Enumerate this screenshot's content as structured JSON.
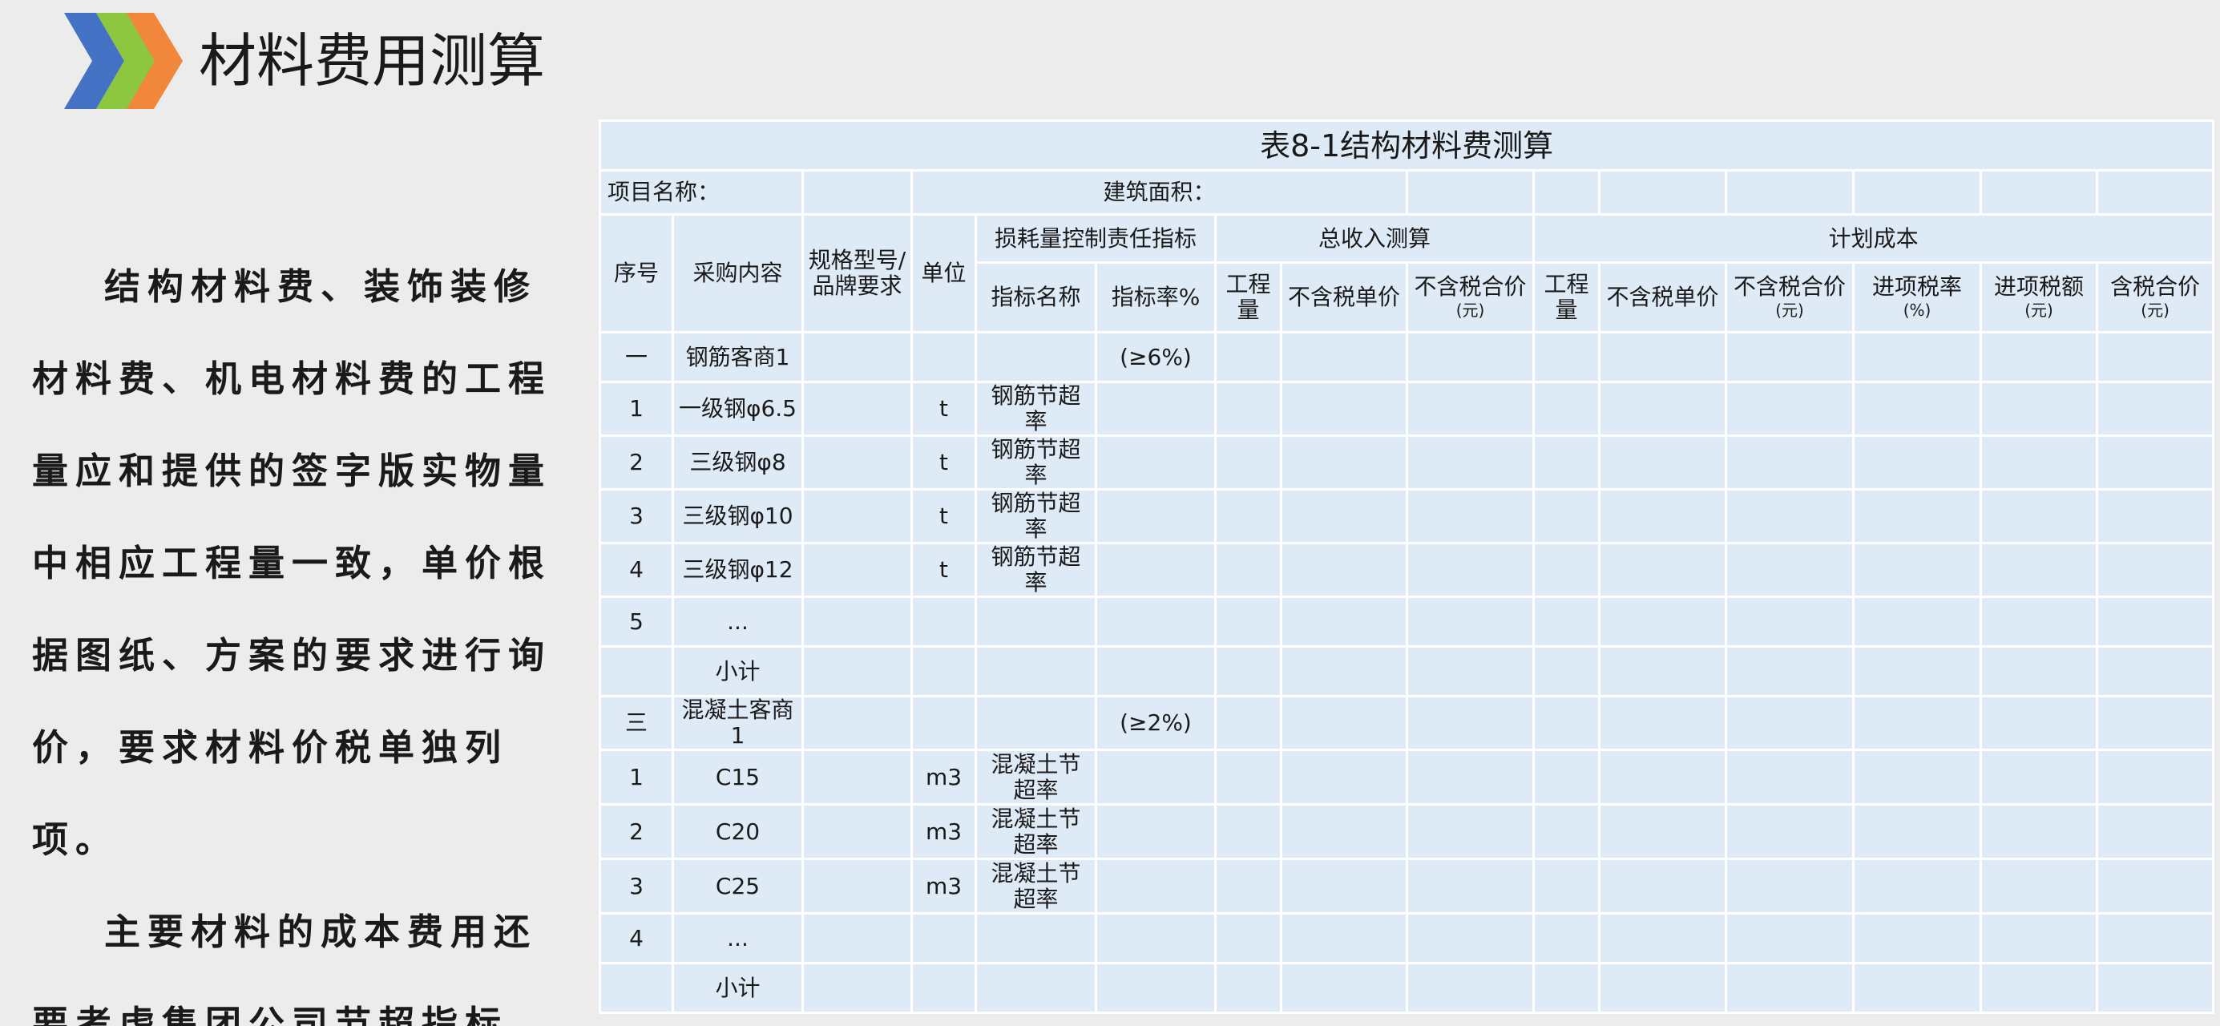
{
  "header": {
    "title": "材料费用测算",
    "colors": {
      "blue": "#4472c4",
      "green": "#8dc63f",
      "orange": "#f0873a"
    }
  },
  "body": {
    "paragraph1": "结构材料费、装饰装修材料费、机电材料费的工程量应和提供的签字版实物量中相应工程量一致，单价根据图纸、方案的要求进行询价，要求材料价税单独列项。",
    "paragraph2": "主要材料的成本费用还要考虑集团公司节超指标。"
  },
  "table": {
    "caption": "表8-1结构材料费测算",
    "project_name_label": "项目名称：",
    "building_area_label": "建筑面积：",
    "headers": {
      "seq": "序号",
      "content": "采购内容",
      "spec": "规格型号/品牌要求",
      "unit": "单位",
      "loss_group": "损耗量控制责任指标",
      "indicator_name": "指标名称",
      "indicator_rate": "指标率%",
      "income_group": "总收入测算",
      "income_qty": "工程量",
      "income_price": "不含税单价",
      "income_total": "不含税合价",
      "income_total_unit": "(元)",
      "plan_group": "计划成本",
      "plan_qty": "工程量",
      "plan_price": "不含税单价",
      "plan_total": "不含税合价",
      "plan_total_unit": "(元)",
      "tax_rate": "进项税率",
      "tax_rate_unit": "(%)",
      "tax_amount": "进项税额",
      "tax_amount_unit": "(元)",
      "taxed_total": "含税合价",
      "taxed_total_unit": "(元)"
    },
    "rows": [
      {
        "seq": "一",
        "content": "钢筋客商1",
        "unit": "",
        "ind_name": "",
        "ind_rate": "(≥6%)"
      },
      {
        "seq": "1",
        "content": "一级钢φ6.5",
        "unit": "t",
        "ind_name": "钢筋节超率",
        "ind_rate": ""
      },
      {
        "seq": "2",
        "content": "三级钢φ8",
        "unit": "t",
        "ind_name": "钢筋节超率",
        "ind_rate": ""
      },
      {
        "seq": "3",
        "content": "三级钢φ10",
        "unit": "t",
        "ind_name": "钢筋节超率",
        "ind_rate": ""
      },
      {
        "seq": "4",
        "content": "三级钢φ12",
        "unit": "t",
        "ind_name": "钢筋节超率",
        "ind_rate": ""
      },
      {
        "seq": "5",
        "content": "...",
        "unit": "",
        "ind_name": "",
        "ind_rate": ""
      },
      {
        "seq": "",
        "content": "小计",
        "unit": "",
        "ind_name": "",
        "ind_rate": ""
      },
      {
        "seq": "三",
        "content": "混凝土客商1",
        "unit": "",
        "ind_name": "",
        "ind_rate": "(≥2%)"
      },
      {
        "seq": "1",
        "content": "C15",
        "unit": "m3",
        "ind_name": "混凝土节超率",
        "ind_rate": ""
      },
      {
        "seq": "2",
        "content": "C20",
        "unit": "m3",
        "ind_name": "混凝土节超率",
        "ind_rate": ""
      },
      {
        "seq": "3",
        "content": "C25",
        "unit": "m3",
        "ind_name": "混凝土节超率",
        "ind_rate": ""
      },
      {
        "seq": "4",
        "content": "...",
        "unit": "",
        "ind_name": "",
        "ind_rate": ""
      },
      {
        "seq": "",
        "content": "小计",
        "unit": "",
        "ind_name": "",
        "ind_rate": ""
      }
    ]
  }
}
